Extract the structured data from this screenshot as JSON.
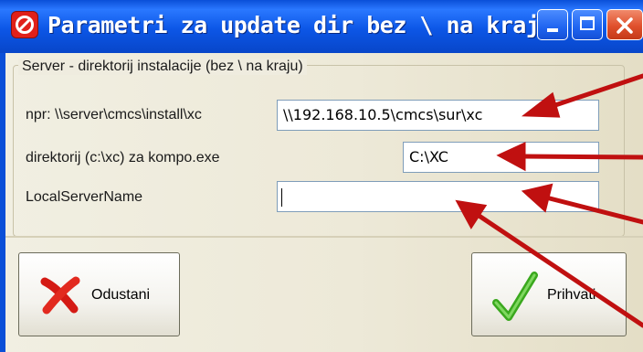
{
  "window": {
    "title": "Parametri za update dir bez \\ na kraju!"
  },
  "group": {
    "legend": "Server - direktorij instalacije (bez \\ na kraju)"
  },
  "fields": [
    {
      "label": "npr: \\\\server\\cmcs\\install\\xc",
      "value": "\\\\192.168.10.5\\cmcs\\sur\\xc"
    },
    {
      "label": "direktorij (c:\\xc) za kompo.exe",
      "value": "C:\\XC"
    },
    {
      "label": "LocalServerName",
      "value": ""
    }
  ],
  "buttons": {
    "cancel_label": "Odustani",
    "accept_label": "Prihvati"
  },
  "colors": {
    "titlebar": "#0a4fd8",
    "close": "#e0502c",
    "arrow": "#c01010",
    "check": "#3aa81e"
  },
  "icons": {
    "app": "red-app-icon",
    "cancel": "red-x-icon",
    "accept": "green-check-icon"
  }
}
